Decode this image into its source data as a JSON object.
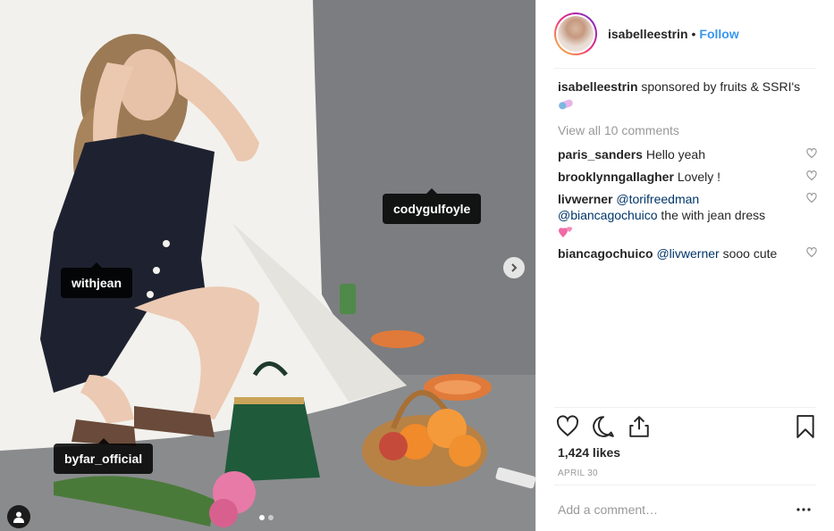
{
  "post": {
    "username": "isabelleestrin",
    "bullet": "•",
    "follow_label": "Follow",
    "caption_text": "sponsored by fruits & SSRI's",
    "caption_emoji_icon": "pill-emoji-icon",
    "view_all_label": "View all 10 comments",
    "comments": [
      {
        "user": "paris_sanders",
        "text": "Hello yeah"
      },
      {
        "user": "brooklynngallagher",
        "text": "Lovely !"
      },
      {
        "user": "livwerner",
        "mention1": "@torifreedman",
        "mention2": "@biancagochuico",
        "text": "the with jean dress",
        "emoji_icon": "two-hearts-emoji-icon"
      },
      {
        "user": "biancagochuico",
        "mention1": "@livwerner",
        "text": "sooo cute"
      }
    ],
    "likes": "1,424 likes",
    "date": "APRIL 30",
    "add_comment_placeholder": "Add a comment…"
  },
  "photo_tags": {
    "tag1": "withjean",
    "tag2": "codygulfoyle",
    "tag3": "byfar_official"
  },
  "carousel": {
    "current": 1,
    "total": 2
  },
  "icons": {
    "like": "heart-icon",
    "comment": "comment-bubble-icon",
    "share": "share-icon",
    "save": "bookmark-icon",
    "more": "more-dots-icon",
    "next": "chevron-right-icon",
    "user_tags": "person-icon"
  },
  "colors": {
    "link": "#3897f0",
    "mention": "#003569",
    "muted": "#999999",
    "tag_bg": "#000000"
  }
}
